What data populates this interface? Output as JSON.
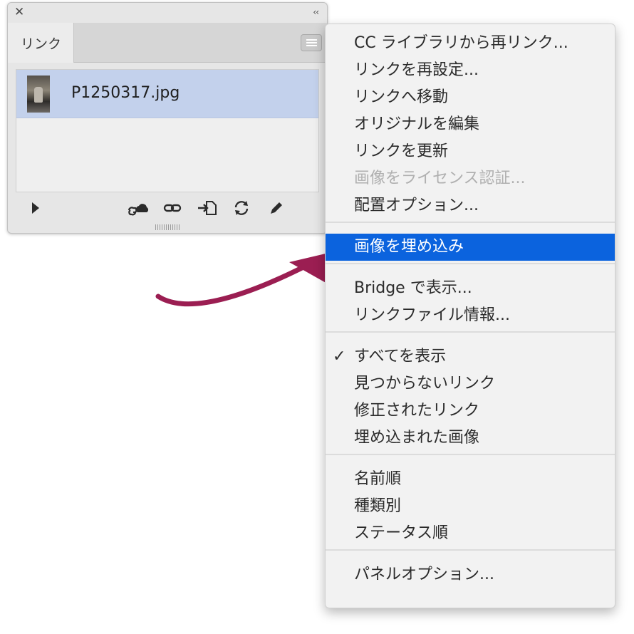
{
  "panel": {
    "close_glyph": "✕",
    "collapse_glyph": "‹‹",
    "tab_label": "リンク",
    "links": [
      {
        "name": "P1250317.jpg",
        "selected": true
      }
    ],
    "toolbar_icons": [
      "expand-triangle-icon",
      "cc-relink-icon",
      "relink-icon",
      "goto-link-icon",
      "update-link-icon",
      "edit-original-icon"
    ]
  },
  "menu": {
    "groups": [
      {
        "items": [
          {
            "label": "CC ライブラリから再リンク..."
          },
          {
            "label": "リンクを再設定..."
          },
          {
            "label": "リンクへ移動"
          },
          {
            "label": "オリジナルを編集"
          },
          {
            "label": "リンクを更新"
          },
          {
            "label": "画像をライセンス認証...",
            "disabled": true
          },
          {
            "label": "配置オプション..."
          }
        ]
      },
      {
        "items": [
          {
            "label": "画像を埋め込み",
            "highlighted": true
          }
        ]
      },
      {
        "items": [
          {
            "label": "Bridge で表示..."
          },
          {
            "label": "リンクファイル情報..."
          }
        ]
      },
      {
        "items": [
          {
            "label": "すべてを表示",
            "checked": true
          },
          {
            "label": "見つからないリンク"
          },
          {
            "label": "修正されたリンク"
          },
          {
            "label": "埋め込まれた画像"
          }
        ]
      },
      {
        "items": [
          {
            "label": "名前順"
          },
          {
            "label": "種類別"
          },
          {
            "label": "ステータス順"
          }
        ]
      },
      {
        "items": [
          {
            "label": "パネルオプション..."
          }
        ]
      }
    ],
    "check_glyph": "✓",
    "highlight_color": "#0b63de"
  },
  "annotation": {
    "arrow_color": "#9b1e52"
  }
}
